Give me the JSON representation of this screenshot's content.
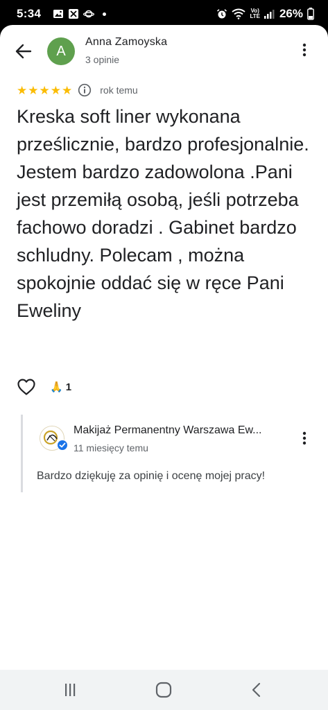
{
  "status_bar": {
    "time": "5:34",
    "battery": "26%",
    "network_label_top": "Vo)",
    "network_label_bottom": "LTE"
  },
  "review": {
    "avatar_letter": "A",
    "reviewer_name": "Anna Zamoyska",
    "reviewer_meta": "3 opinie",
    "rating": 5,
    "date": "rok temu",
    "text": "Kreska soft liner wykonana prześlicznie, bardzo profesjonalnie. Jestem bardzo zadowolona .Pani jest przemiłą osobą, jeśli potrzeba fachowo doradzi . Gabinet bardzo schludny. Polecam , można spokojnie oddać się w ręce Pani Eweliny",
    "reaction_emoji": "🙏",
    "reaction_count": "1"
  },
  "owner_reply": {
    "owner_name": "Makijaż Permanentny Warszawa Ew...",
    "date": "11 miesięcy temu",
    "text": "Bardzo dziękuję za opinię i ocenę mojej pracy!"
  },
  "colors": {
    "star": "#fbbc04",
    "avatar": "#5fa04e",
    "verified": "#1a73e8"
  }
}
